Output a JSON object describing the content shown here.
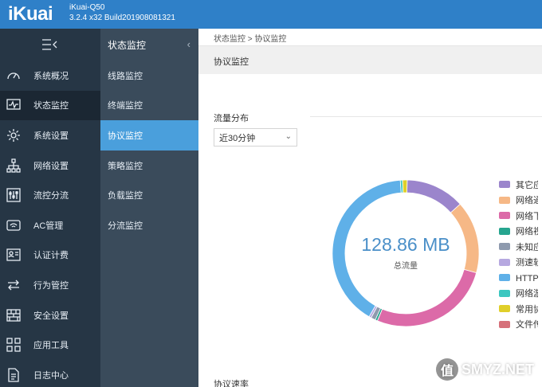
{
  "header": {
    "logo": "iKuai",
    "model": "iKuai-Q50",
    "build": "3.2.4 x32 Build201908081321",
    "bg_color": "#2f80c8"
  },
  "main_nav": {
    "toggle_icon": "collapse-menu-icon",
    "items": [
      {
        "label": "系统概况",
        "icon": "dashboard-icon"
      },
      {
        "label": "状态监控",
        "icon": "monitor-icon",
        "active": true
      },
      {
        "label": "系统设置",
        "icon": "gear-icon"
      },
      {
        "label": "网络设置",
        "icon": "network-icon"
      },
      {
        "label": "流控分流",
        "icon": "sliders-icon"
      },
      {
        "label": "AC管理",
        "icon": "wifi-icon"
      },
      {
        "label": "认证计费",
        "icon": "id-card-icon"
      },
      {
        "label": "行为管控",
        "icon": "arrows-icon"
      },
      {
        "label": "安全设置",
        "icon": "firewall-icon"
      },
      {
        "label": "应用工具",
        "icon": "apps-icon"
      },
      {
        "label": "日志中心",
        "icon": "log-icon"
      }
    ]
  },
  "sub_nav": {
    "title": "状态监控",
    "items": [
      {
        "label": "线路监控"
      },
      {
        "label": "终端监控"
      },
      {
        "label": "协议监控",
        "active": true
      },
      {
        "label": "策略监控"
      },
      {
        "label": "负载监控"
      },
      {
        "label": "分流监控"
      }
    ]
  },
  "content": {
    "breadcrumb": "状态监控 > 协议监控",
    "page_title": "协议监控",
    "section_label": "流量分布",
    "time_select": "近30分钟",
    "rate_label": "协议速率"
  },
  "chart_data": {
    "type": "pie",
    "center_value": "128.86 MB",
    "center_label": "总流量",
    "slices": [
      {
        "name": "其它应",
        "value": 13,
        "color": "#9b85cc"
      },
      {
        "name": "网络通",
        "value": 16,
        "color": "#f6b886"
      },
      {
        "name": "网络下",
        "value": 27,
        "color": "#dc6aa8"
      },
      {
        "name": "网络视",
        "value": 0.5,
        "color": "#26a58f"
      },
      {
        "name": "未知应",
        "value": 1,
        "color": "#8e9aae"
      },
      {
        "name": "测速软",
        "value": 0.5,
        "color": "#b6a8e0"
      },
      {
        "name": "HTTP协",
        "value": 40.5,
        "color": "#5fb0e8"
      },
      {
        "name": "网络游",
        "value": 0.5,
        "color": "#3cc7c0"
      },
      {
        "name": "常用协",
        "value": 1,
        "color": "#e0cf2a"
      },
      {
        "name": "文件传",
        "value": 0,
        "color": "#d6707a"
      }
    ]
  },
  "watermark": "SMYZ.NET"
}
